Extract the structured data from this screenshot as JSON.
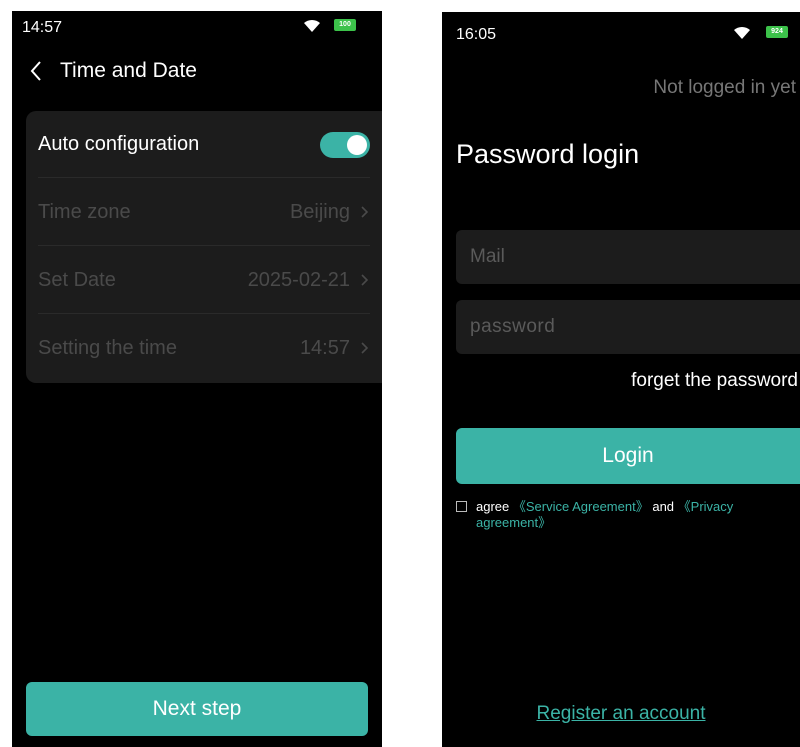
{
  "colors": {
    "accent": "#3bb3a6",
    "screen_bg": "#000000",
    "card_bg": "#1c1c1c",
    "disabled_text": "#4a4a4a"
  },
  "left_screen": {
    "status_time": "14:57",
    "battery": "100",
    "title": "Time and Date",
    "settings": {
      "auto_config_label": "Auto configuration",
      "auto_config_on": true,
      "time_zone_label": "Time zone",
      "time_zone_value": "Beijing",
      "set_date_label": "Set Date",
      "set_date_value": "2025-02-21",
      "set_time_label": "Setting the time",
      "set_time_value": "14:57"
    },
    "next_button": "Next step"
  },
  "right_screen": {
    "status_time": "16:05",
    "battery": "924",
    "login_status": "Not logged in yet",
    "heading": "Password login",
    "mail_placeholder": "Mail",
    "password_placeholder": "password",
    "forgot_password": "forget the password",
    "login_button": "Login",
    "agree_prefix": "agree",
    "service_agreement": "《Service Agreement》",
    "and_text": "and",
    "privacy_agreement": "《Privacy agreement》",
    "register_link": "Register an account"
  }
}
